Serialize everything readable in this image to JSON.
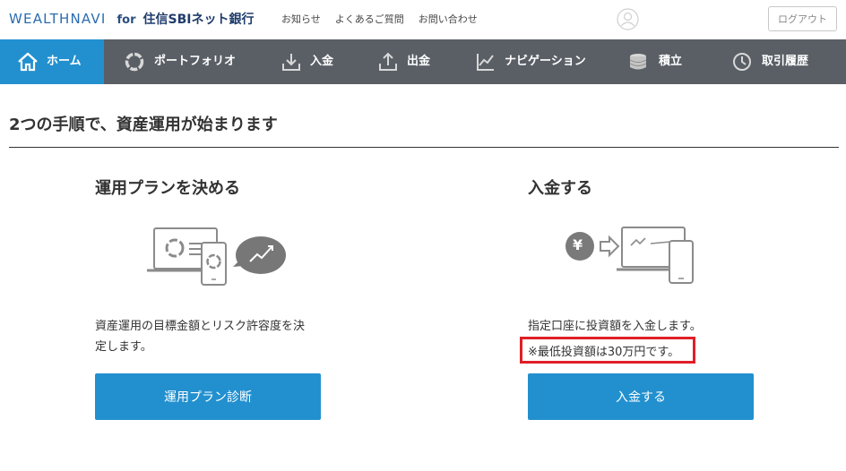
{
  "header": {
    "logo_main": "WEALTHNAVI",
    "logo_for": "for",
    "logo_bank": "住信SBIネット銀行",
    "links": [
      "お知らせ",
      "よくあるご質問",
      "お問い合わせ"
    ],
    "logout_label": "ログアウト"
  },
  "nav": {
    "items": [
      {
        "label": "ホーム",
        "icon": "home-icon",
        "active": true
      },
      {
        "label": "ポートフォリオ",
        "icon": "portfolio-ring-icon",
        "active": false
      },
      {
        "label": "入金",
        "icon": "deposit-icon",
        "active": false
      },
      {
        "label": "出金",
        "icon": "withdraw-icon",
        "active": false
      },
      {
        "label": "ナビゲーション",
        "icon": "chart-line-icon",
        "active": false
      },
      {
        "label": "積立",
        "icon": "coins-stack-icon",
        "active": false
      },
      {
        "label": "取引履歴",
        "icon": "clock-icon",
        "active": false
      }
    ]
  },
  "main": {
    "title": "2つの手順で、資産運用が始まります",
    "steps": [
      {
        "title": "運用プランを決める",
        "desc_line1": "資産運用の目標金額とリスク許容度を決",
        "desc_line2": "定します。",
        "button": "運用プラン診断"
      },
      {
        "title": "入金する",
        "desc_line1": "指定口座に投資額を入金します。",
        "note": "※最低投資額は30万円です。",
        "button": "入金する",
        "yen_symbol": "¥"
      }
    ]
  },
  "colors": {
    "brand_blue": "#2290cf",
    "nav_bg": "#5a5f66",
    "highlight_red": "#e01f26"
  }
}
